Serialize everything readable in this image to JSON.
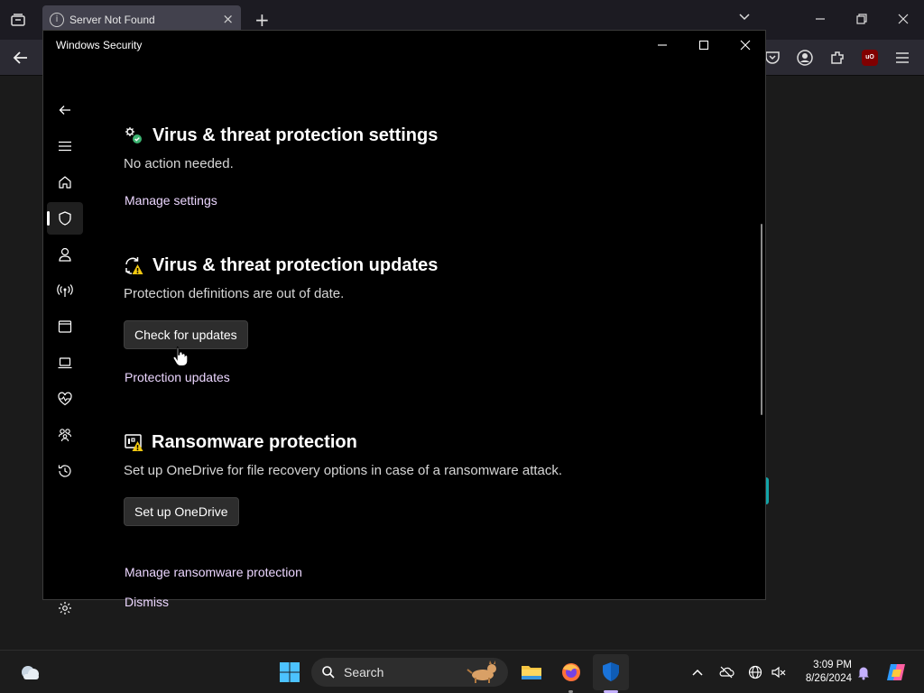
{
  "browser": {
    "tab_title": "Server Not Found",
    "page_fragment_text": ")"
  },
  "window": {
    "title": "Windows Security"
  },
  "sidebar": {
    "items": [
      {
        "name": "back",
        "icon": "back-arrow-icon"
      },
      {
        "name": "menu",
        "icon": "hamburger-menu-icon"
      },
      {
        "name": "home",
        "icon": "home-icon"
      },
      {
        "name": "virus-threat-protection",
        "icon": "shield-icon",
        "active": true
      },
      {
        "name": "account-protection",
        "icon": "person-icon"
      },
      {
        "name": "firewall-network",
        "icon": "wireless-antenna-icon"
      },
      {
        "name": "app-browser-control",
        "icon": "app-window-icon"
      },
      {
        "name": "device-security",
        "icon": "laptop-icon"
      },
      {
        "name": "device-performance-health",
        "icon": "heart-pulse-icon"
      },
      {
        "name": "family-options",
        "icon": "family-icon"
      },
      {
        "name": "protection-history",
        "icon": "history-icon"
      },
      {
        "name": "settings",
        "icon": "gear-icon"
      }
    ]
  },
  "sections": {
    "settings": {
      "title": "Virus & threat protection settings",
      "desc": "No action needed.",
      "link": "Manage settings"
    },
    "updates": {
      "title": "Virus & threat protection updates",
      "desc": "Protection definitions are out of date.",
      "button": "Check for updates",
      "link": "Protection updates"
    },
    "ransomware": {
      "title": "Ransomware protection",
      "desc": "Set up OneDrive for file recovery options in case of a ransomware attack.",
      "button": "Set up OneDrive",
      "link": "Manage ransomware protection",
      "dismiss": "Dismiss"
    }
  },
  "taskbar": {
    "search_label": "Search",
    "time": "3:09 PM",
    "date": "8/26/2024"
  },
  "colors": {
    "link": "#ecd6ff",
    "accent": "#c4b0ff",
    "warning": "#f2c811",
    "ok": "#3cb371"
  }
}
